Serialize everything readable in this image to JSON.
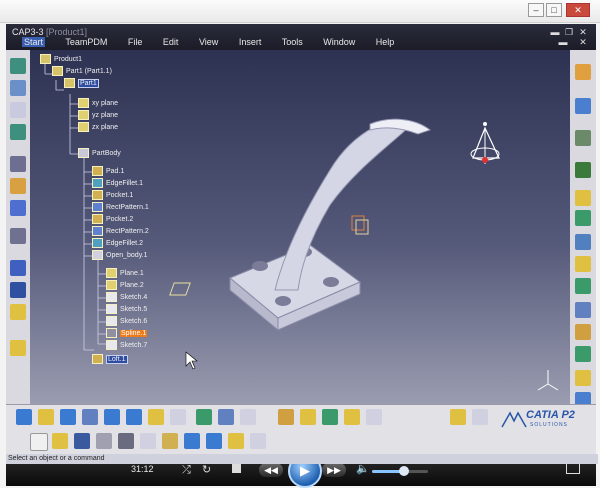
{
  "window": {
    "title": "CAP3-3",
    "doc_title": "[Product1]"
  },
  "menu": {
    "items": [
      "Start",
      "TeamPDM",
      "File",
      "Edit",
      "View",
      "Insert",
      "Tools",
      "Window",
      "Help"
    ]
  },
  "tree": {
    "product": "Product1",
    "part": "Part1 (Part1.1)",
    "part_node": "Part1",
    "planes": [
      "xy plane",
      "yz plane",
      "zx plane"
    ],
    "partbody": "PartBody",
    "features": [
      "Pad.1",
      "EdgeFillet.1",
      "Pocket.1",
      "RectPattern.1",
      "Pocket.2",
      "RectPattern.2",
      "EdgeFillet.2",
      "Open_body.1",
      "Plane.1",
      "Plane.2",
      "Sketch.4",
      "Sketch.5",
      "Sketch.6",
      "Spline.1",
      "Sketch.7",
      "Loft.1"
    ],
    "selected_feature": "Spline.1"
  },
  "branding": {
    "logo": "CATIA P2",
    "sub": "SOLUTIONS"
  },
  "player": {
    "time": "31:12",
    "volume_fraction": 0.55
  },
  "status_bar": {
    "text": "Select an object or a command"
  },
  "colors": {
    "viewport_top": "#2d3152",
    "viewport_bottom": "#9a9cb0",
    "selection": "#ef7a1a",
    "model": "#d4d6e6"
  }
}
